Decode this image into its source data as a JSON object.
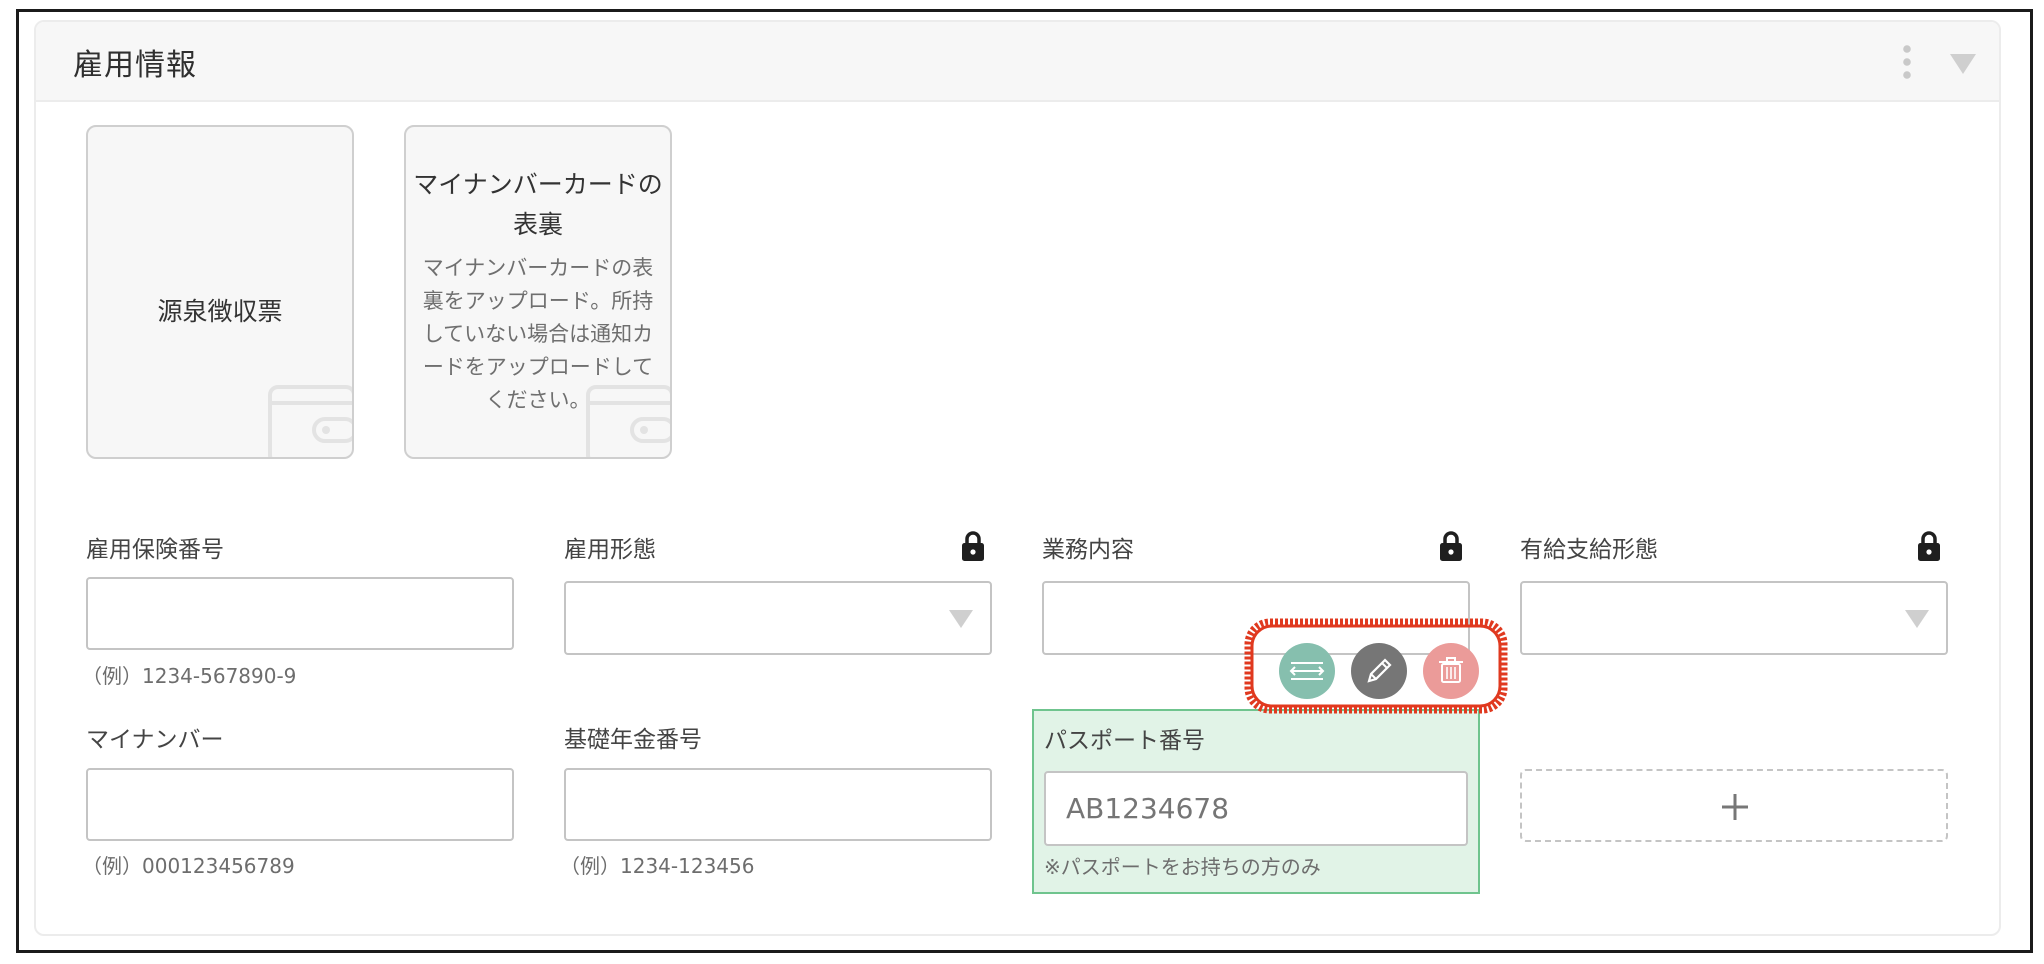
{
  "section": {
    "title": "雇用情報"
  },
  "upload_cards": [
    {
      "title": "源泉徴収票",
      "description": ""
    },
    {
      "title_line1": "マイナンバーカードの",
      "title_line2": "表裏",
      "description_lines": [
        "マイナンバーカードの表",
        "裏をアップロード。所持",
        "していない場合は通知カ",
        "ードをアップロードして",
        "ください。"
      ]
    }
  ],
  "fields": {
    "employment_insurance_number": {
      "label": "雇用保険番号",
      "value": "",
      "hint": "（例）1234-567890-9"
    },
    "employment_type": {
      "label": "雇用形態",
      "value": ""
    },
    "job_description": {
      "label": "業務内容",
      "value": ""
    },
    "paid_leave_type": {
      "label": "有給支給形態",
      "value": ""
    },
    "my_number": {
      "label": "マイナンバー",
      "value": "",
      "hint": "（例）000123456789"
    },
    "basic_pension_number": {
      "label": "基礎年金番号",
      "value": "",
      "hint": "（例）1234-123456"
    },
    "passport_number": {
      "label": "パスポート番号",
      "value": "",
      "placeholder": "AB1234678",
      "note": "※パスポートをお持ちの方のみ"
    }
  },
  "add_field": {
    "label": "+"
  },
  "field_actions": {
    "icons": [
      "swap-icon",
      "pencil-icon",
      "trash-icon"
    ],
    "colors": {
      "swap": "#86bfae",
      "edit": "#767676",
      "delete": "#eb9b99",
      "annotation": "#e0391f",
      "highlight": "#e1f3e7",
      "highlight_border": "#6fc48e"
    }
  }
}
